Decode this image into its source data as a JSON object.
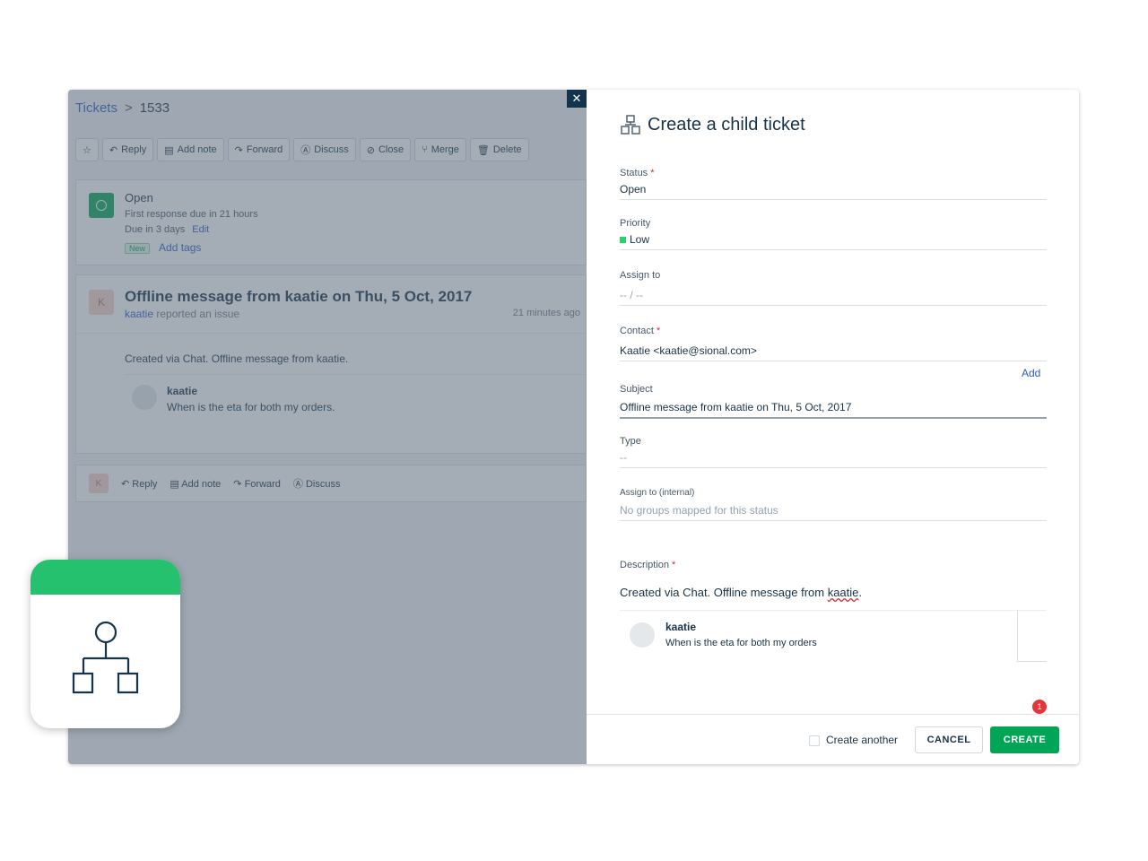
{
  "breadcrumb": {
    "root": "Tickets",
    "separator": ">",
    "id": "1533"
  },
  "toolbar": {
    "reply": "Reply",
    "add_note": "Add note",
    "forward": "Forward",
    "discuss": "Discuss",
    "close": "Close",
    "merge": "Merge",
    "delete": "Delete"
  },
  "status_card": {
    "status": "Open",
    "first_response": "First response due in 21 hours",
    "due": "Due in 3 days",
    "edit": "Edit",
    "badge": "New",
    "add_tags": "Add tags"
  },
  "conversation": {
    "avatar": "K",
    "title": "Offline message from kaatie on Thu, 5 Oct, 2017",
    "reporter": "kaatie",
    "reported_text": "reported an issue",
    "time": "21 minutes ago",
    "body": "Created via Chat. Offline message from kaatie.",
    "quote_name": "kaatie",
    "quote_text": "When is the eta for both my orders."
  },
  "reply_bar": {
    "avatar": "K",
    "reply": "Reply",
    "add_note": "Add note",
    "forward": "Forward",
    "discuss": "Discuss"
  },
  "panel": {
    "title": "Create a child ticket",
    "status": {
      "label": "Status",
      "value": "Open"
    },
    "priority": {
      "label": "Priority",
      "value": "Low"
    },
    "assign_to": {
      "label": "Assign to",
      "value": "-- / --"
    },
    "contact": {
      "label": "Contact",
      "value": "Kaatie <kaatie@sional.com>"
    },
    "add_link": "Add",
    "subject": {
      "label": "Subject",
      "value": "Offline message from kaatie on Thu, 5 Oct, 2017"
    },
    "type": {
      "label": "Type",
      "value": "--"
    },
    "assign_internal": {
      "label": "Assign to (internal)",
      "value": "No groups mapped for this status"
    },
    "description": {
      "label": "Description",
      "text_prefix": "Created via Chat. Offline message from ",
      "text_name": "kaatie",
      "text_suffix": ".",
      "quote_name": "kaatie",
      "quote_text": "When is the eta for both my orders"
    },
    "notification_count": "1",
    "create_another": "Create another",
    "cancel": "CANCEL",
    "create": "CREATE"
  },
  "colors": {
    "accent_green": "#00a656",
    "app_icon_green": "#25c16f",
    "link_blue": "#2c5cc5",
    "priority_low": "#2ad36a"
  }
}
